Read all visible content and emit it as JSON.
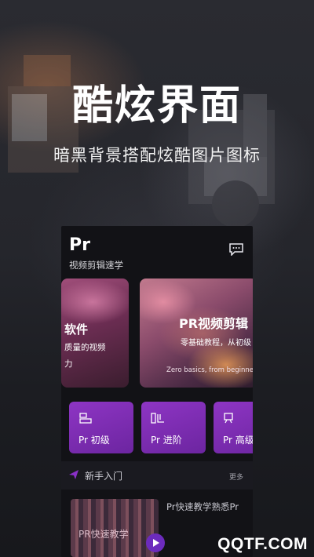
{
  "promo": {
    "title": "酷炫界面",
    "subtitle": "暗黑背景搭配炫酷图片图标"
  },
  "app": {
    "logo": "Pr",
    "subtitle": "视频剪辑速学",
    "message_icon": "chat-bubble-icon"
  },
  "banners": [
    {
      "title": "软件",
      "line1": "质量的视频",
      "line2": "力"
    },
    {
      "title": "PR视频剪辑",
      "subtitle": "零基础教程，从初级",
      "english": "Zero basics, from beginner"
    }
  ],
  "levels": [
    {
      "label": "Pr 初级",
      "icon": "beginner-icon"
    },
    {
      "label": "Pr 进阶",
      "icon": "advanced-icon"
    },
    {
      "label": "Pr 高级",
      "icon": "expert-icon"
    }
  ],
  "section": {
    "title": "新手入门",
    "more": "更多",
    "icon": "send-icon"
  },
  "course": {
    "thumb_label": "PR快速教学",
    "title": "Pr快速教学熟悉Pr"
  },
  "watermark": "QQTF.COM",
  "colors": {
    "accent_purple": "#7a2db3",
    "background": "#121216"
  }
}
